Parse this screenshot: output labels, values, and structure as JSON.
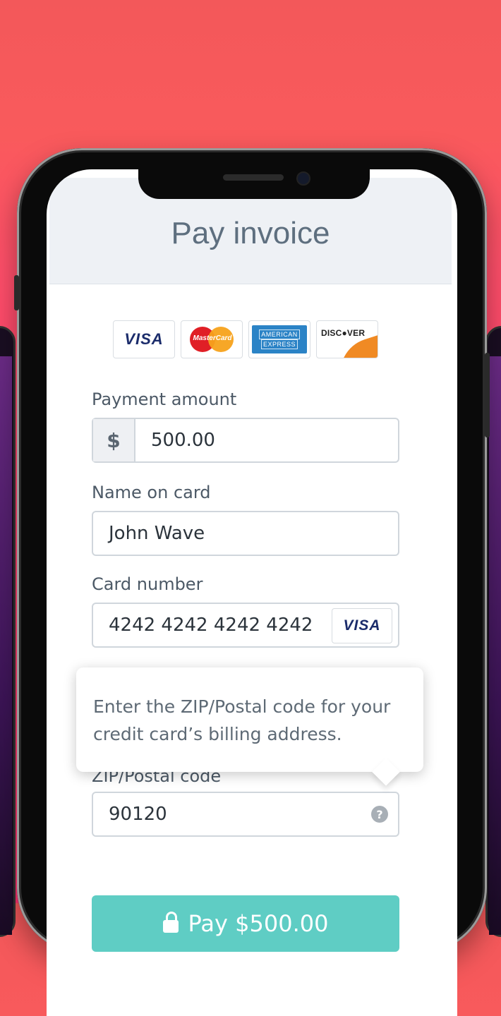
{
  "header": {
    "title": "Pay invoice"
  },
  "card_logos": {
    "visa": "VISA",
    "mastercard": "MasterCard",
    "amex_line1": "AMERICAN",
    "amex_line2": "EXPRESS",
    "discover": "DISC●VER"
  },
  "payment_amount": {
    "label": "Payment amount",
    "prefix": "$",
    "value": "500.00"
  },
  "name_on_card": {
    "label": "Name on card",
    "value": "John Wave"
  },
  "card_number": {
    "label": "Card number",
    "value": "4242 4242 4242 4242",
    "brand": "VISA"
  },
  "zip": {
    "label": "ZIP/Postal code",
    "value": "90120",
    "help": "?"
  },
  "tooltip": {
    "text": "Enter the ZIP/Postal code for your credit card’s billing address."
  },
  "pay_button": {
    "label": "Pay $500.00"
  },
  "colors": {
    "accent": "#5fcdc4",
    "background": "#ff4f6a",
    "header_bg": "#eef1f5"
  }
}
